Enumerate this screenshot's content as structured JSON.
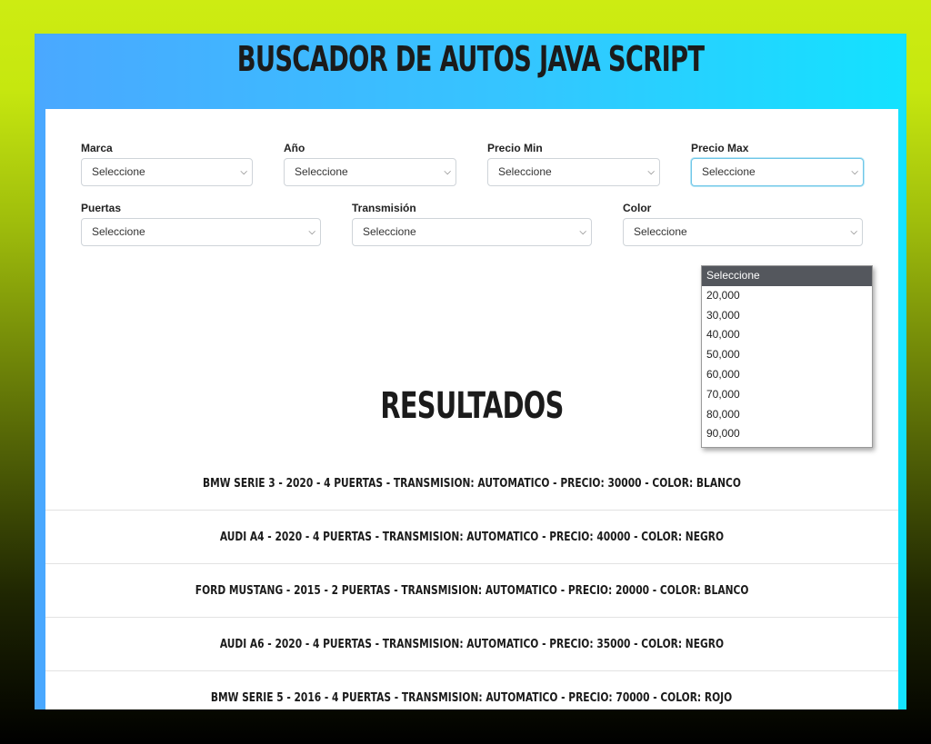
{
  "header": {
    "title": "Buscador de Autos Java Script"
  },
  "filters": {
    "marca": {
      "label": "Marca",
      "value": "Seleccione"
    },
    "year": {
      "label": "Año",
      "value": "Seleccione"
    },
    "precio_min": {
      "label": "Precio Min",
      "value": "Seleccione"
    },
    "precio_max": {
      "label": "Precio Max",
      "value": "Seleccione",
      "open": true,
      "options": [
        "Seleccione",
        "20,000",
        "30,000",
        "40,000",
        "50,000",
        "60,000",
        "70,000",
        "80,000",
        "90,000"
      ]
    },
    "puertas": {
      "label": "Puertas",
      "value": "Seleccione"
    },
    "transmision": {
      "label": "Transmisión",
      "value": "Seleccione"
    },
    "color": {
      "label": "Color",
      "value": "Seleccione"
    }
  },
  "results": {
    "title": "Resultados",
    "items": [
      "BMW Serie 3 - 2020 - 4 Puertas - Transmision: automatico - Precio: 30000 - Color: Blanco",
      "Audi A4 - 2020 - 4 Puertas - Transmision: automatico - Precio: 40000 - Color: Negro",
      "Ford Mustang - 2015 - 2 Puertas - Transmision: automatico - Precio: 20000 - Color: Blanco",
      "Audi A6 - 2020 - 4 Puertas - Transmision: automatico - Precio: 35000 - Color: Negro",
      "BMW Serie 5 - 2016 - 4 Puertas - Transmision: automatico - Precio: 70000 - Color: Rojo"
    ]
  },
  "colors": {
    "accent_start": "#4aa8ff",
    "accent_end": "#13e2ff",
    "background_top": "#cdec12",
    "background_bottom": "#000000"
  },
  "icons": {
    "select_arrow": "chevron-down-icon"
  }
}
